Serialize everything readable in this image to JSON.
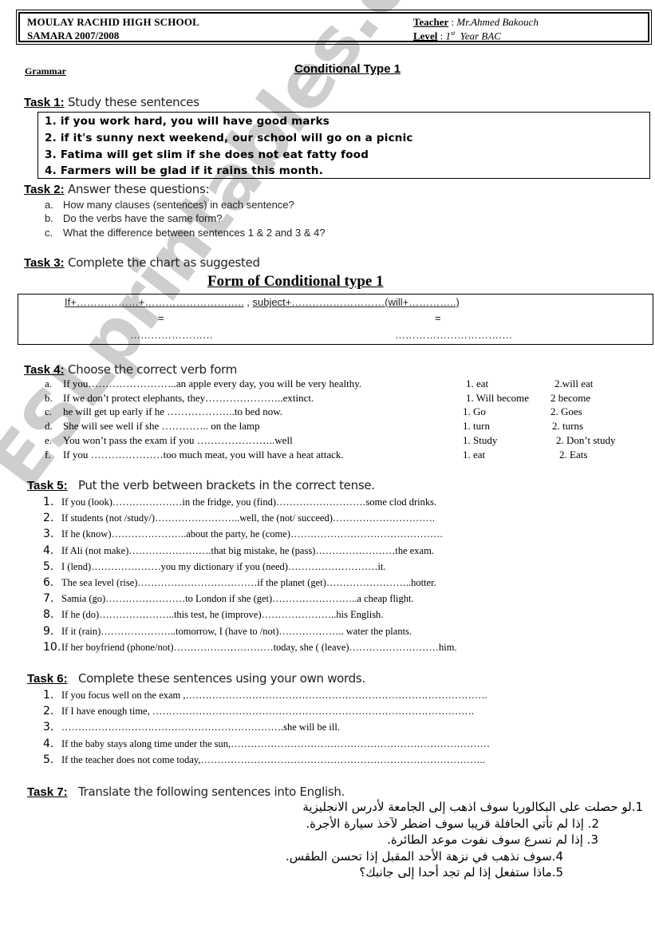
{
  "header": {
    "school": "MOULAY RACHID HIGH SCHOOL",
    "year": "SAMARA 2007/2008",
    "teacher_label": "Teacher",
    "teacher_sep": " : ",
    "teacher_name": "Mr.Ahmed Bakouch",
    "level_label": "Level",
    "level_sep": " : ",
    "level_num": "1",
    "level_sup": "st",
    "level_rest": "  Year BAC"
  },
  "subject": "Grammar",
  "title": "Conditional Type 1",
  "task1": {
    "label": "Task 1:",
    "text": " Study these sentences",
    "items": [
      "1.  if you work hard, you will have good marks",
      "2.  if it's sunny next weekend, our school will go on a picnic",
      "3.  Fatima will get slim if she does not eat fatty food",
      "4.  Farmers will be glad if it rains this month."
    ]
  },
  "task2": {
    "label": "Task 2:",
    "text": " Answer these questions:",
    "items": [
      {
        "marker": "a.",
        "text": "How many clauses (sentences) in each sentence?"
      },
      {
        "marker": "b.",
        "text": "Do the verbs have the same form?"
      },
      {
        "marker": "c.",
        "text": "What the difference between sentences 1 & 2 and 3 & 4?"
      }
    ]
  },
  "task3": {
    "label": "Task 3:",
    "text": " Complete the chart as suggested",
    "chart_title": "Form of Conditional type 1",
    "row1_left": "If+………………+………………………..",
    "row1_comma": " , ",
    "row1_right": "subject+………………………(will+…………..)",
    "eq": "=",
    "blank_left": "……………………",
    "blank_right": "……………………………."
  },
  "task4": {
    "label": "Task 4:",
    "text": " Choose the correct verb form",
    "items": [
      {
        "marker": "a.",
        "text": "If you……………………..an apple every day, you will be very healthy.",
        "opt1": "1. eat",
        "opt2": "2.will eat"
      },
      {
        "marker": "b.",
        "text": "If we don’t protect elephants, they…………………..extinct.",
        "opt1": "1. Will become",
        "opt2": "2 become"
      },
      {
        "marker": "c.",
        "text": "he will get up early if  he ………………..to bed now.",
        "opt1": "1. Go",
        "opt2": "2. Goes"
      },
      {
        "marker": "d.",
        "text": "She will see well if she ………….. on the lamp",
        "opt1": "1. turn",
        "opt2": "2. turns"
      },
      {
        "marker": "e.",
        "text": "You won’t pass the exam if you …………………..well",
        "opt1": "1. Study",
        "opt2": "2. Don’t study"
      },
      {
        "marker": "f.",
        "text": "If you …………………too much meat, you will have a heat attack.",
        "opt1": "1. eat",
        "opt2": "2. Eats"
      }
    ]
  },
  "task5": {
    "label": "Task 5:",
    "text": "   Put the verb between brackets in the correct tense.",
    "items": [
      {
        "n": "1.",
        "text": "If you (look)…………………in the fridge, you (find)………………………some clod drinks."
      },
      {
        "n": "2.",
        "text": "If students (not /study/)……………………..well, the (not/ succeed)…………………………."
      },
      {
        "n": "3.",
        "text": "If he (know)…………………..about the party, he (come)………………………………………."
      },
      {
        "n": "4.",
        "text": "If Ali (not make)…………………….that big mistake, he (pass)……………………the exam."
      },
      {
        "n": "5.",
        "text": "I (lend)…………………you my dictionary if you (need)………………………it."
      },
      {
        "n": "6.",
        "text": "The sea level (rise)………………………………if the planet (get)……………………..hotter."
      },
      {
        "n": "7.",
        "text": "Samia (go)……………………to London if she (get)……………………..a cheap flight."
      },
      {
        "n": "8.",
        "text": "If he (do)…………………..this test, he (improve)…………………..his English."
      },
      {
        "n": "9.",
        "text": "If it (rain)…………………..tomorrow,  I (have to /not)……………….. water the plants."
      },
      {
        "n": "10.",
        "text": "If her boyfriend (phone/not)…………………………today, she ( (leave)………………………him."
      }
    ]
  },
  "task6": {
    "label": "Task 6:",
    "text": "   Complete these sentences using your own words.",
    "items": [
      {
        "n": "1.",
        "text": "If you focus well on the exam ,………………………………………………………………………………."
      },
      {
        "n": "2.",
        "text": "If I have enough time, ……………………………………………………………………………………."
      },
      {
        "n": "3.",
        "text": "………………………………………………………….she will be ill."
      },
      {
        "n": "4.",
        "text": "If the baby stays along time under the sun,……………………………………………………………………"
      },
      {
        "n": "5.",
        "text": "If the teacher does not come today,………………………………………………………………………….."
      }
    ]
  },
  "task7": {
    "label": "Task 7:",
    "text": "   Translate the following sentences into English.",
    "items": [
      "1.لو حصلت على البكالوريا سوف اذهب إلى الجامعة لأدرس الانجليزية",
      "2. إذا لم تأتي الحافلة قريبا سوف اضطر لآخذ سيارة الأجرة.",
      "3. إذا لم نسرع سوف نفوت موعد الطائرة.",
      "4.سوف نذهب في نزهة الأحد المقبل إذا تحسن الطقس.",
      "5.ماذا ستفعل إذا لم تجد أحدا إلى جانبك؟"
    ]
  },
  "watermark": "ESLprintables.com"
}
